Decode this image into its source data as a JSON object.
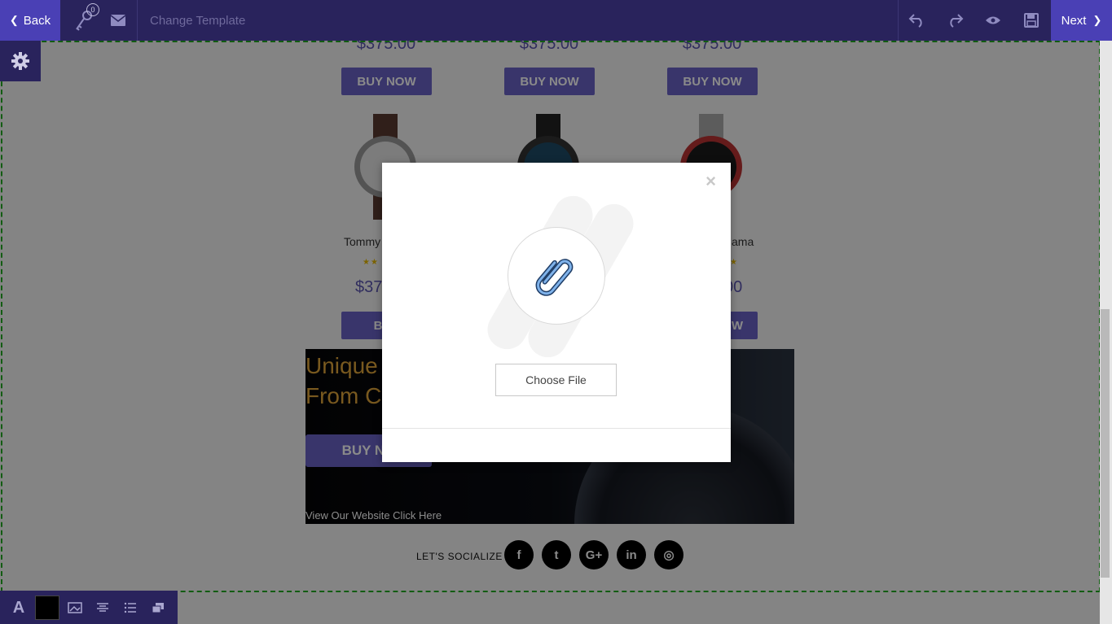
{
  "topbar": {
    "back_label": "Back",
    "key_count": "0",
    "template_label": "Change Template",
    "next_label": "Next"
  },
  "products": {
    "top_prices": [
      "$375.00",
      "$375.00",
      "$375.00"
    ],
    "buy_label": "BUY NOW",
    "row2": [
      {
        "name": "Tommy",
        "price": "$37",
        "buy": "BUY",
        "stars": "★★"
      },
      {
        "name": "",
        "price": "",
        "buy": "",
        "stars": ""
      },
      {
        "name": "ama",
        "price": "00",
        "buy": "W",
        "stars": "★"
      }
    ]
  },
  "banner": {
    "title": "Unique\nFrom C",
    "buy_label": "BUY NO",
    "link_text": "View Our Website Click Here"
  },
  "social": {
    "label": "LET'S SOCIALIZE",
    "icons": [
      "facebook-icon",
      "twitter-icon",
      "google-plus-icon",
      "linkedin-icon",
      "instagram-icon"
    ],
    "glyphs": [
      "f",
      "t",
      "G+",
      "in",
      "◎"
    ]
  },
  "modal": {
    "close_glyph": "×",
    "choose_file_label": "Choose File"
  },
  "colors": {
    "topbar": "#29235c",
    "accent": "#4a40b5",
    "buy_button": "#6a63c6",
    "price": "#5c55b0",
    "banner_title": "#e0a53a",
    "dashed_border": "#22aa22"
  }
}
